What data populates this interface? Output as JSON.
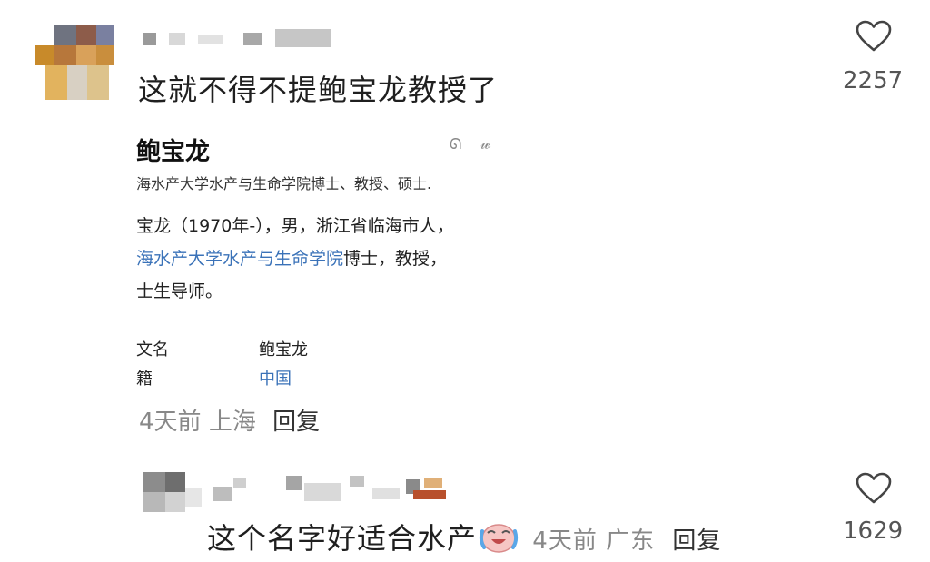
{
  "comments": [
    {
      "text": "这就不得不提鲍宝龙教授了",
      "likes": "2257",
      "time": "4天前",
      "location": "上海",
      "reply_label": "回复",
      "embedded_card": {
        "title": "鲍宝龙",
        "tools": "ᘏ 𝓌",
        "subtitle": "海水产大学水产与生命学院博士、教授、硕士.",
        "body_line1": "宝龙（1970年-），男，浙江省临海市人，",
        "body_line2_link": "海水产大学水产与生命学院",
        "body_line2_rest": "博士，教授，",
        "body_line3": "士生导师。",
        "info": [
          {
            "label": "文名",
            "value": "鲍宝龙",
            "is_link": false
          },
          {
            "label": "籍",
            "value": "中国",
            "is_link": true
          }
        ]
      }
    },
    {
      "text": "这个名字好适合水产",
      "emoji": "crying-laughing-emoji",
      "likes": "1629",
      "time": "4天前",
      "location": "广东",
      "reply_label": "回复"
    }
  ],
  "icons": {
    "like": "heart-outline-icon"
  }
}
